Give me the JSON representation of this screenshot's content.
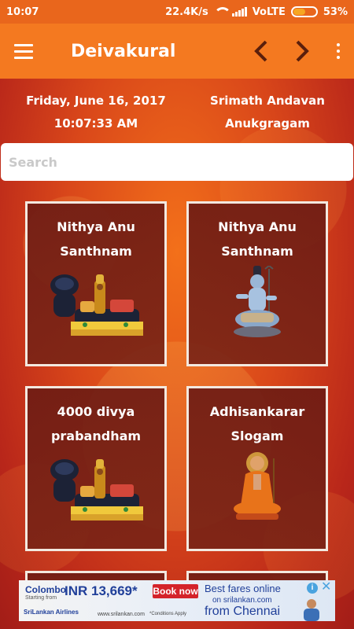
{
  "status_bar": {
    "time": "10:07",
    "network_speed": "22.4K/s",
    "network_type": "VoLTE",
    "battery": "53%",
    "battery_level": 0.53
  },
  "app_bar": {
    "title": "Deivakural",
    "icons": [
      "menu-icon",
      "chevron-left-icon",
      "chevron-right-icon",
      "more-vertical-icon"
    ]
  },
  "info": {
    "date": "Friday, June 16, 2017",
    "time": "10:07:33 AM",
    "line1": "Srimath Andavan",
    "line2": "Anukgragam"
  },
  "search": {
    "placeholder": "Search",
    "value": ""
  },
  "cards": [
    {
      "line1": "Nithya Anu",
      "line2": "Santhnam",
      "image": "reclining-vishnu-image"
    },
    {
      "line1": "Nithya Anu",
      "line2": "Santhnam",
      "image": "shiva-image"
    },
    {
      "line1": "4000 divya",
      "line2": "prabandham",
      "image": "reclining-vishnu-image"
    },
    {
      "line1": "Adhisankarar",
      "line2": "Slogam",
      "image": "adi-shankara-image"
    }
  ],
  "ad": {
    "city": "Colombo",
    "from_small": "Starting from",
    "price": "INR 13,669*",
    "book_label": "Book now",
    "airline": "SriLankan Airlines",
    "site_small": "www.srilankan.com",
    "conditions": "*Conditions Apply",
    "headline": "Best fares online",
    "on_site": "on srilankan.com",
    "from_city": "from Chennai"
  },
  "colors": {
    "app_bar": "#f47920",
    "status_bar": "#e9661c",
    "card_border": "#f3e9e0",
    "ad_accent": "#21409a"
  }
}
